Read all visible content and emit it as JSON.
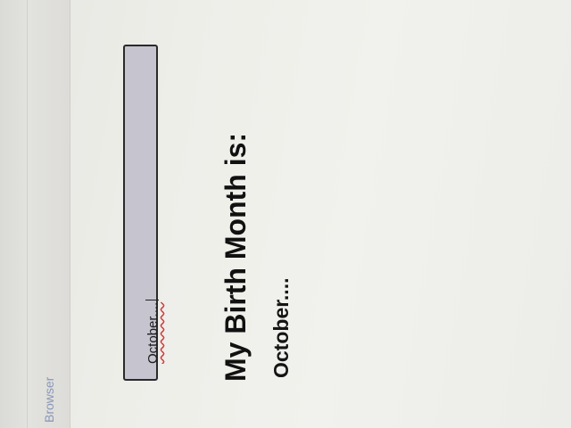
{
  "browser": {
    "label": "Browser"
  },
  "form": {
    "input_value": "October....",
    "heading": "My Birth Month is:",
    "output": "October...."
  },
  "colors": {
    "input_background": "#c5c4cf",
    "heading_text": "#111111",
    "browser_label": "#8a98b8",
    "spellcheck_underline": "#d23a3a"
  }
}
